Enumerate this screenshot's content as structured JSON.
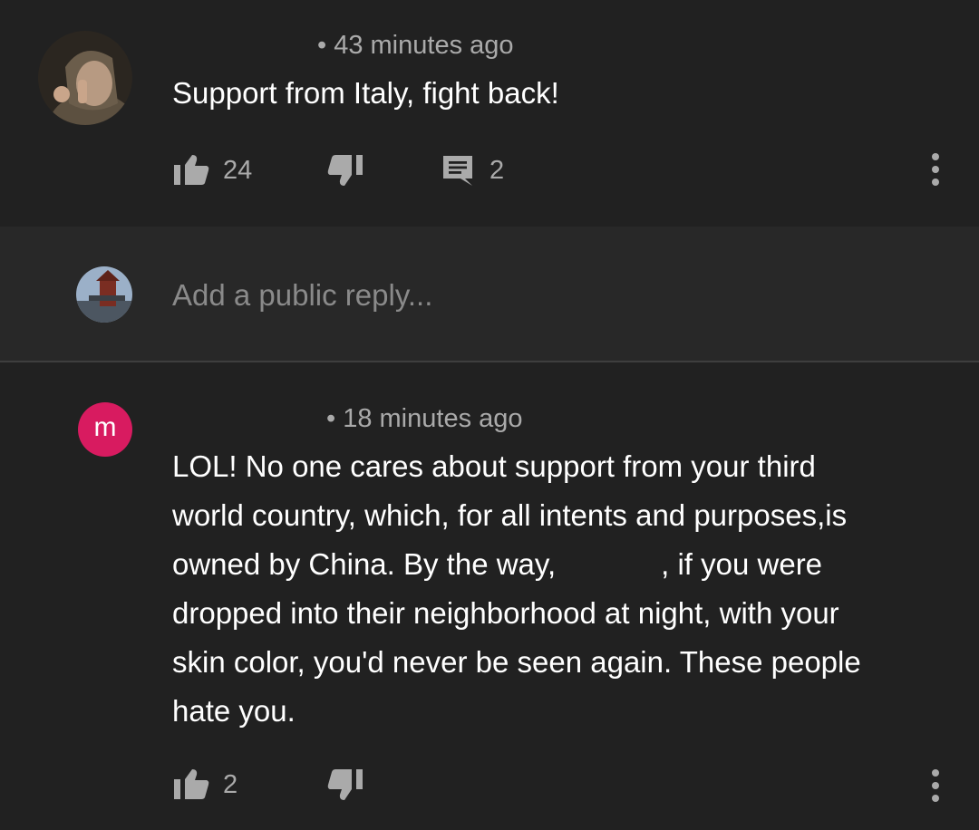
{
  "comment1": {
    "timestamp": "• 43 minutes ago",
    "text": "Support from Italy, fight back!",
    "likes": "24",
    "replies": "2"
  },
  "reply_box": {
    "placeholder": "Add a public reply..."
  },
  "comment2": {
    "avatar_letter": "m",
    "avatar_color": "#d81b60",
    "timestamp": "• 18 minutes ago",
    "text_lines": [
      "LOL! No one cares about support from your third",
      "world country, which, for all intents and purposes,is",
      "owned by China. By the way,",
      ", if you were",
      "dropped into their neighborhood at night, with your",
      "skin color, you'd never be seen again. These people",
      "hate you."
    ],
    "likes": "2"
  }
}
